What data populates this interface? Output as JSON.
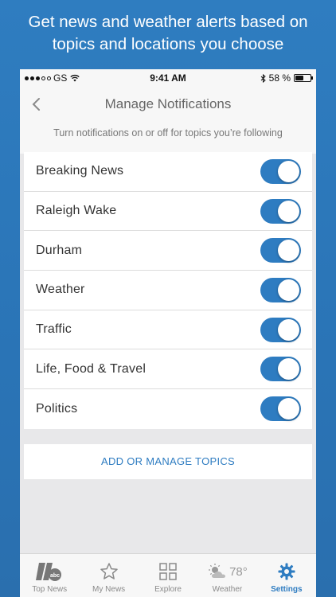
{
  "promo": {
    "line1": "Get news and weather alerts based on",
    "line2": "topics and locations you choose"
  },
  "status": {
    "carrier": "GS",
    "time": "9:41 AM",
    "battery": "58 %",
    "battery_level": 0.58
  },
  "nav": {
    "title": "Manage Notifications"
  },
  "hint": "Turn notifications on or off for topics you’re following",
  "topics": [
    {
      "label": "Breaking News",
      "on": true
    },
    {
      "label": "Raleigh Wake",
      "on": true
    },
    {
      "label": "Durham",
      "on": true
    },
    {
      "label": "Weather",
      "on": true
    },
    {
      "label": "Traffic",
      "on": true
    },
    {
      "label": "Life, Food & Travel",
      "on": true
    },
    {
      "label": "Politics",
      "on": true
    }
  ],
  "manage_label": "ADD OR MANAGE TOPICS",
  "tabs": {
    "top_news": "Top News",
    "my_news": "My News",
    "explore": "Explore",
    "weather": "Weather",
    "weather_temp": "78°",
    "settings": "Settings"
  },
  "colors": {
    "accent": "#2e7cc1",
    "background": "#2f7dc0"
  }
}
